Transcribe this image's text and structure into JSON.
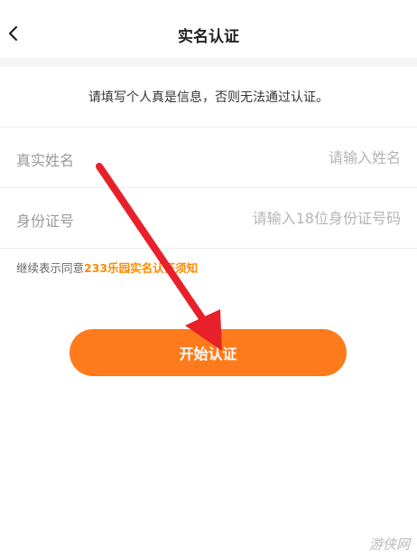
{
  "header": {
    "back_icon": "chevron-left-icon",
    "title": "实名认证"
  },
  "notice": {
    "text": "请填写个人真是信息，否则无法通过认证。"
  },
  "form": {
    "name": {
      "label": "真实姓名",
      "placeholder": "请输入姓名",
      "value": ""
    },
    "id_number": {
      "label": "身份证号",
      "placeholder": "请输入18位身份证号码",
      "value": ""
    }
  },
  "agreement": {
    "prefix": "继续表示同意",
    "link": "233乐园实名认证须知"
  },
  "actions": {
    "start_label": "开始认证"
  },
  "annotation": {
    "arrow_color": "#e8202a"
  },
  "colors": {
    "accent": "#ff7a1a",
    "link": "#ff8a00"
  },
  "watermark": {
    "text": "游侠网"
  }
}
